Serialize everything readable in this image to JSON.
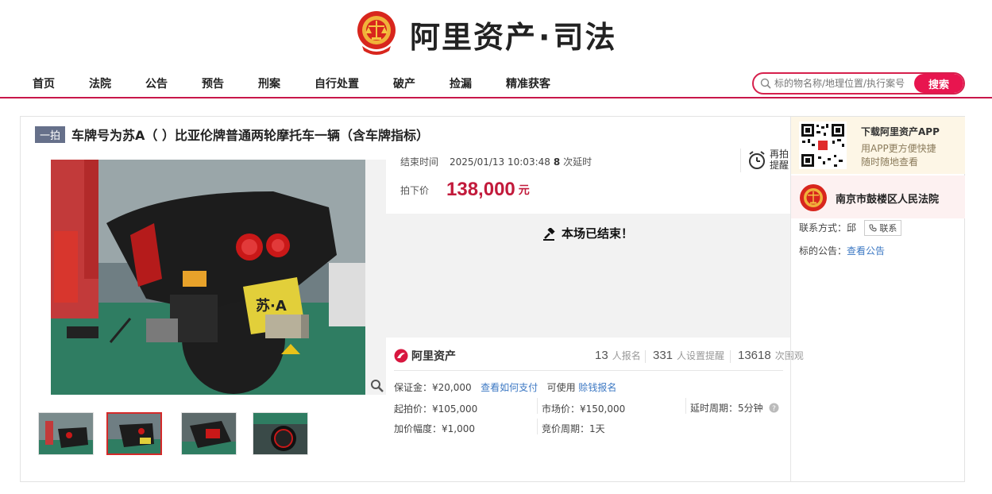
{
  "site": {
    "logo_text_left": "阿里资产",
    "logo_sep": "·",
    "logo_text_right": "司法",
    "brand_color": "#e8154f"
  },
  "nav": {
    "items": [
      "首页",
      "法院",
      "公告",
      "预告",
      "刑案",
      "自行处置",
      "破产",
      "捡漏",
      "精准获客"
    ],
    "search_placeholder": "标的物名称/地理位置/执行案号",
    "search_button": "搜索"
  },
  "auction": {
    "tag": "一拍",
    "title": "车牌号为苏A（ ）比亚伦牌普通两轮摩托车一辆（含车牌指标）",
    "end_time_label": "结束时间",
    "end_time_value": "2025/01/13 10:03:48",
    "delay_count": "8",
    "delay_text": "次延时",
    "remind_label": "再拍提醒",
    "price_label": "拍下价",
    "price_value": "138,000",
    "price_unit": "元",
    "ended_text": "本场已结束！",
    "platform_name": "阿里资产",
    "signups": "13",
    "signups_unit": "人报名",
    "reminders": "331",
    "reminders_unit": "人设置提醒",
    "views": "13618",
    "views_unit": "次围观",
    "deposit_label": "保证金：",
    "deposit_value": "¥20,000",
    "deposit_link": "查看如何支付",
    "usable_label": "可使用",
    "usable_link": "赊钱报名",
    "start_price_label": "起拍价：",
    "start_price_value": "¥105,000",
    "market_price_label": "市场价：",
    "market_price_value": "¥150,000",
    "delay_cycle_label": "延时周期：",
    "delay_cycle_value": "5分钟",
    "increment_label": "加价幅度：",
    "increment_value": "¥1,000",
    "bid_cycle_label": "竞价周期：",
    "bid_cycle_value": "1天"
  },
  "plate_text": "苏·A",
  "sidebar": {
    "app_title": "下载阿里资产APP",
    "app_line1": "用APP更方便快捷",
    "app_line2": "随时随地查看",
    "court_name": "南京市鼓楼区人民法院",
    "contact_label": "联系方式：",
    "contact_person": "邱",
    "contact_button": "联系",
    "notice_label": "标的公告：",
    "notice_link": "查看公告"
  }
}
